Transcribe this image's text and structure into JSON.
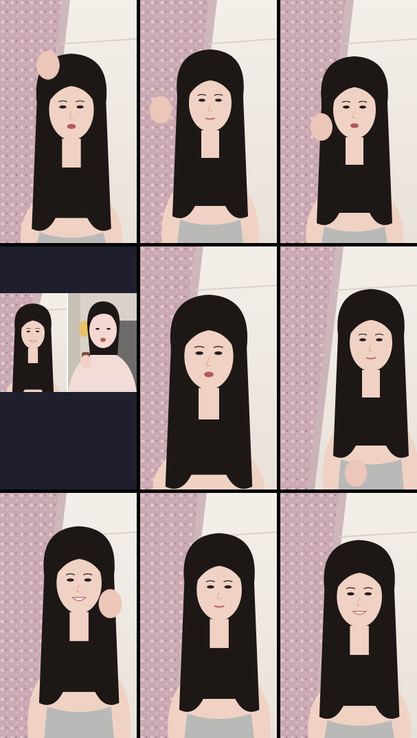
{
  "layout": {
    "description_free": true,
    "tiles": [
      {
        "id": "r1c1",
        "pose": "hand-in-hair",
        "mouth": "open"
      },
      {
        "id": "r1c2",
        "pose": "hand-at-ear",
        "mouth": "closed"
      },
      {
        "id": "r1c3",
        "pose": "hand-at-cheek",
        "mouth": "open"
      },
      {
        "id": "r2c1",
        "pose": "split-call",
        "mouth": "smile"
      },
      {
        "id": "r2c2",
        "pose": "facing-camera",
        "mouth": "open"
      },
      {
        "id": "r2c3",
        "pose": "looking-side",
        "mouth": "closed"
      },
      {
        "id": "r3c1",
        "pose": "chin-on-hand",
        "mouth": "smile"
      },
      {
        "id": "r3c2",
        "pose": "facing-camera",
        "mouth": "closed"
      },
      {
        "id": "r3c3",
        "pose": "laughing",
        "mouth": "smile"
      }
    ]
  },
  "colors": {
    "wall": "#e9e2da",
    "ceiling": "#f3efe9",
    "curtain": "#c9a9b2",
    "curtain_dark": "#a9828f",
    "skin": "#f0d2c4",
    "hair": "#1d1716",
    "top": "#b9bab8",
    "dark_panel": "#1f1e2c"
  }
}
